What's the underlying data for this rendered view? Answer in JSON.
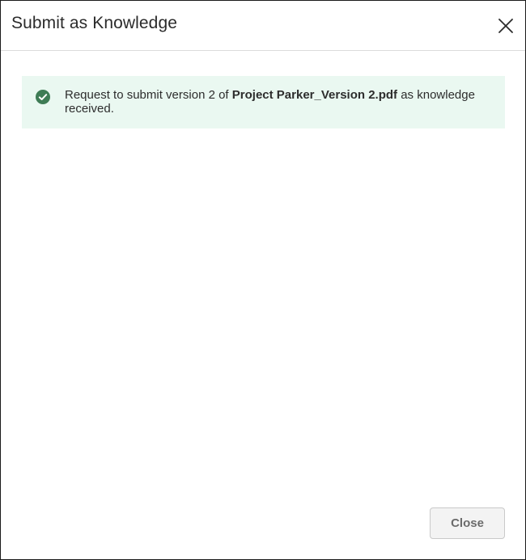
{
  "dialog": {
    "title": "Submit as Knowledge",
    "close_icon": "close-icon"
  },
  "alert": {
    "icon": "check-circle-icon",
    "icon_color": "#3e7c55",
    "background": "#eaf8f1",
    "text_before": "Request to submit version 2 of ",
    "filename": "Project Parker_Version 2.pdf",
    "text_after": " as knowledge received."
  },
  "footer": {
    "close_label": "Close"
  }
}
